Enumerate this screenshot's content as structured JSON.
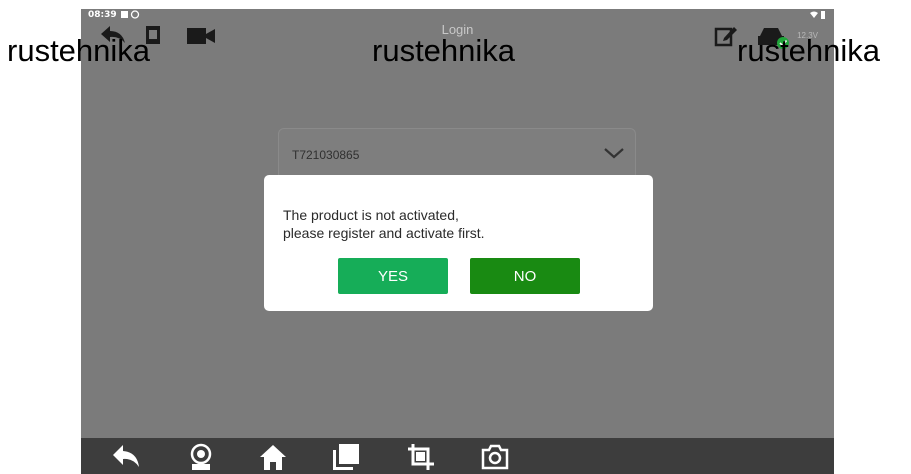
{
  "status_bar": {
    "time": "08:39"
  },
  "topbar": {
    "title": "Login",
    "voltage": "12.3V"
  },
  "login": {
    "serial_number": "T721030865"
  },
  "dialog": {
    "message_line1": "The product is not activated,",
    "message_line2": "please register and activate first.",
    "yes_label": "YES",
    "no_label": "NO"
  },
  "watermark": {
    "text": "rustehnika"
  },
  "colors": {
    "screen_bg": "#7b7b7b",
    "yes_button": "#16ad58",
    "no_button": "#198a12",
    "navbar_bg": "#3d3d3d",
    "connected_badge": "#20a53a"
  },
  "navbar": {
    "icons": [
      "back-icon",
      "diagnose-icon",
      "home-icon",
      "recent-apps-icon",
      "screenshot-crop-icon",
      "camera-icon"
    ]
  }
}
